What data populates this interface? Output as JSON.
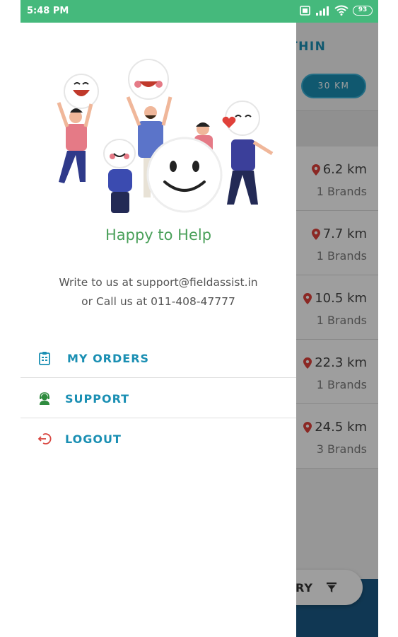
{
  "status_bar": {
    "time": "5:48 PM",
    "battery": "93",
    "icons": [
      "sim-icon",
      "signal-icon",
      "wifi-icon",
      "battery-icon"
    ]
  },
  "background_screen": {
    "heading_fragment": "THIN",
    "chip_label": "30 KM",
    "rows": [
      {
        "distance": "6.2 km",
        "brands": "1 Brands"
      },
      {
        "distance": "7.7 km",
        "brands": "1 Brands"
      },
      {
        "distance": "10.5 km",
        "brands": "1 Brands"
      },
      {
        "distance": "22.3 km",
        "brands": "1 Brands"
      },
      {
        "distance": "24.5 km",
        "brands": "3 Brands"
      }
    ],
    "fab_label": "RY"
  },
  "drawer": {
    "title": "Happy to Help",
    "contact_line1": "Write to us at support@fieldassist.in",
    "contact_line2": "or Call us at 011-408-47777",
    "menu": [
      {
        "label": "MY ORDERS",
        "icon": "orders-icon"
      },
      {
        "label": "SUPPORT",
        "icon": "support-icon"
      },
      {
        "label": "LOGOUT",
        "icon": "logout-icon"
      }
    ]
  },
  "colors": {
    "status_bar": "#45b97c",
    "accent": "#1a8fb3",
    "title_green": "#4aa05a",
    "logout_red": "#d8453f",
    "pin_red": "#e0413a"
  }
}
